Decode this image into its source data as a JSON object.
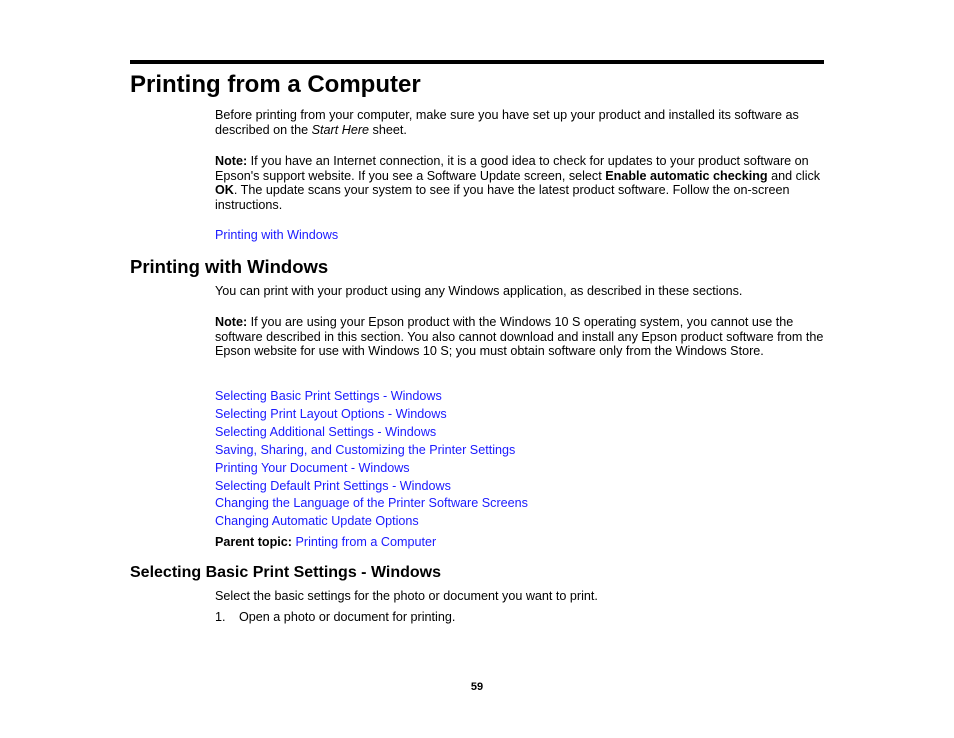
{
  "page": {
    "title": "Printing from a Computer",
    "intro": {
      "before": "Before printing from your computer, make sure you have set up your product and installed its software as described on the ",
      "italic": "Start Here",
      "after": " sheet."
    },
    "note1": {
      "label": "Note:",
      "text1": " If you have an Internet connection, it is a good idea to check for updates to your product software on Epson's support website. If you see a Software Update screen, select ",
      "bold1": "Enable automatic checking",
      "text2": " and click ",
      "bold2": "OK",
      "text3": ". The update scans your system to see if you have the latest product software. Follow the on-screen instructions."
    },
    "link_printing_windows": "Printing with Windows",
    "section2": {
      "title": "Printing with Windows",
      "intro": "You can print with your product using any Windows application, as described in these sections.",
      "note": {
        "label": "Note:",
        "text": " If you are using your Epson product with the Windows 10 S operating system, you cannot use the software described in this section. You also cannot download and install any Epson product software from the Epson website for use with Windows 10 S; you must obtain software only from the Windows Store."
      },
      "links": [
        "Selecting Basic Print Settings - Windows",
        "Selecting Print Layout Options - Windows",
        "Selecting Additional Settings - Windows",
        "Saving, Sharing, and Customizing the Printer Settings",
        "Printing Your Document - Windows",
        "Selecting Default Print Settings - Windows",
        "Changing the Language of the Printer Software Screens",
        "Changing Automatic Update Options"
      ],
      "parent_label": "Parent topic:",
      "parent_link": "Printing from a Computer"
    },
    "section3": {
      "title": "Selecting Basic Print Settings - Windows",
      "intro": "Select the basic settings for the photo or document you want to print.",
      "steps": [
        {
          "num": "1.",
          "text": "Open a photo or document for printing."
        }
      ]
    },
    "page_number": "59"
  }
}
